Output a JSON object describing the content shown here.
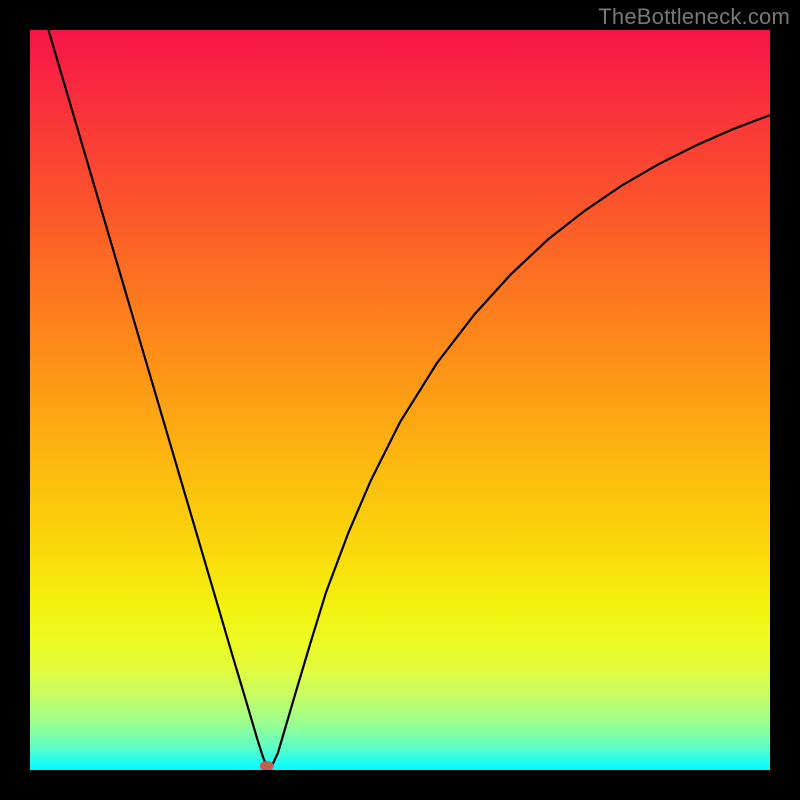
{
  "watermark": "TheBottleneck.com",
  "chart_data": {
    "type": "line",
    "title": "",
    "xlabel": "",
    "ylabel": "",
    "xlim": [
      0,
      100
    ],
    "ylim": [
      0,
      100
    ],
    "grid": false,
    "legend": false,
    "background_gradient": {
      "stops": [
        {
          "pos": 0,
          "color": "#f61447"
        },
        {
          "pos": 8,
          "color": "#f82b3f"
        },
        {
          "pos": 16,
          "color": "#fa4034"
        },
        {
          "pos": 24,
          "color": "#fb562b"
        },
        {
          "pos": 32,
          "color": "#fc6d23"
        },
        {
          "pos": 40,
          "color": "#fd831c"
        },
        {
          "pos": 48,
          "color": "#fd9a16"
        },
        {
          "pos": 56,
          "color": "#fdb111"
        },
        {
          "pos": 64,
          "color": "#fcc70d"
        },
        {
          "pos": 72,
          "color": "#f9de0c"
        },
        {
          "pos": 78,
          "color": "#f3f310"
        },
        {
          "pos": 82,
          "color": "#eef920"
        },
        {
          "pos": 86,
          "color": "#e4fb3a"
        },
        {
          "pos": 90,
          "color": "#c7fd63"
        },
        {
          "pos": 94,
          "color": "#96fe95"
        },
        {
          "pos": 97,
          "color": "#5cfec6"
        },
        {
          "pos": 99,
          "color": "#1efdf4"
        },
        {
          "pos": 100,
          "color": "#02fbff"
        }
      ]
    },
    "marker": {
      "x": 32,
      "y": 0,
      "color": "#c06050",
      "radius": 1.2
    },
    "series": [
      {
        "name": "curve",
        "color": "#000000",
        "x": [
          2.5,
          5,
          7.5,
          10,
          12.5,
          15,
          17.5,
          20,
          22.5,
          25,
          27.5,
          29,
          30,
          30.8,
          31.5,
          32,
          32.3,
          32.8,
          33.5,
          34.5,
          36,
          38,
          40,
          43,
          46,
          50,
          55,
          60,
          65,
          70,
          75,
          80,
          85,
          90,
          95,
          100
        ],
        "y": [
          100,
          91.5,
          83,
          74.5,
          66,
          57.5,
          49,
          40.5,
          32,
          23.5,
          15,
          10,
          6.6,
          3.9,
          1.7,
          0.5,
          0.25,
          0.8,
          2.3,
          5.7,
          10.8,
          17.5,
          24,
          32,
          39,
          47,
          55,
          61.5,
          67,
          71.7,
          75.6,
          79,
          81.9,
          84.4,
          86.6,
          88.5
        ]
      }
    ]
  }
}
